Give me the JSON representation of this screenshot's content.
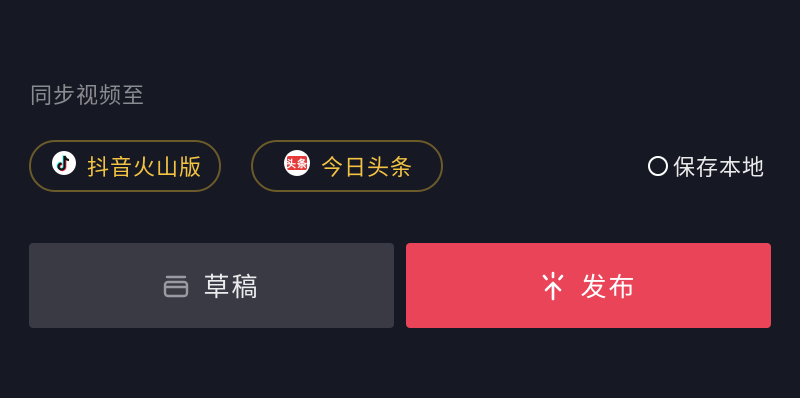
{
  "sync": {
    "label": "同步视频至",
    "targets": [
      {
        "label": "抖音火山版",
        "icon": "douyin-huoshan-logo-icon"
      },
      {
        "label": "今日头条",
        "icon": "toutiao-logo-icon",
        "icon_text": "头条"
      }
    ]
  },
  "save_local": {
    "label": "保存本地",
    "checked": false
  },
  "actions": {
    "draft_label": "草稿",
    "publish_label": "发布"
  },
  "colors": {
    "background": "#161823",
    "chip_text": "#f3c343",
    "chip_border": "#6b5a2a",
    "draft_button": "#393a44",
    "publish_button": "#ea4459"
  }
}
